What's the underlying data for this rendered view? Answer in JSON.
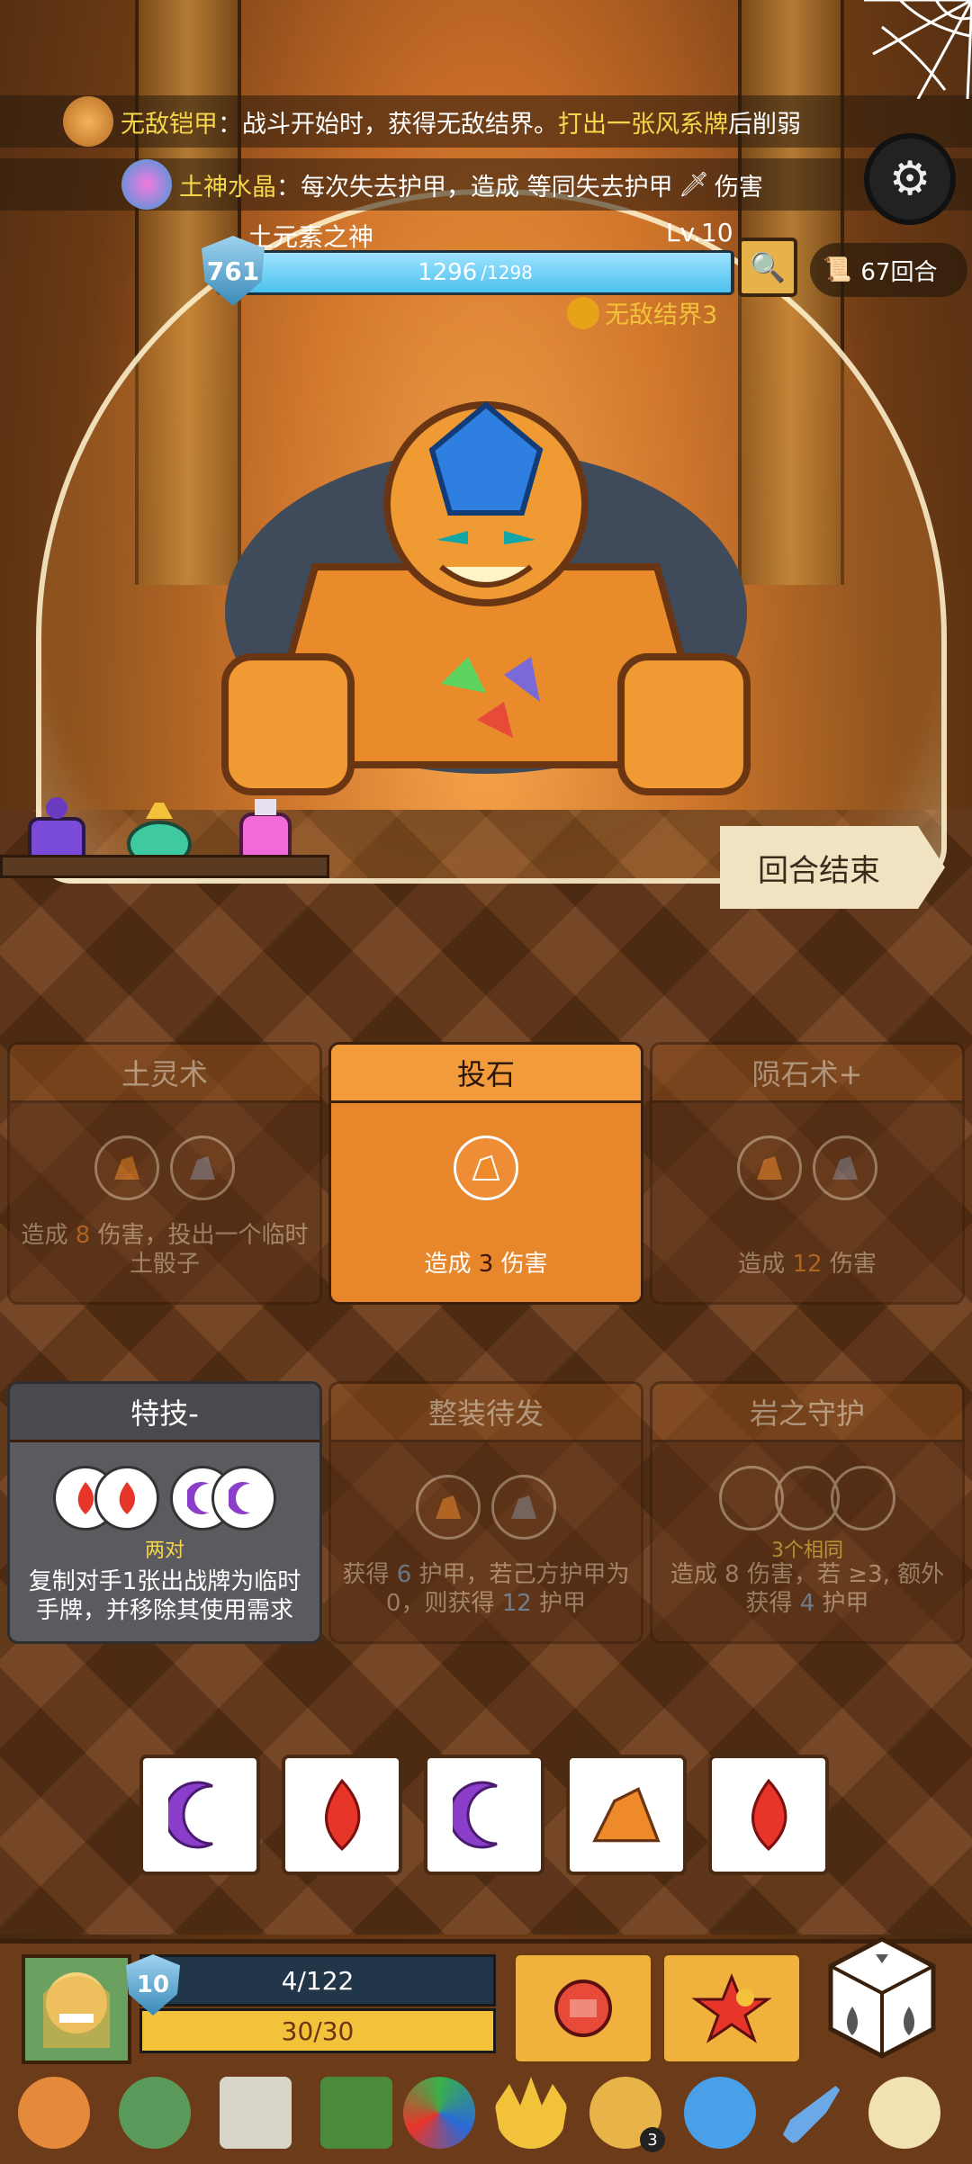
{
  "status_effects": [
    {
      "name": "无敌铠甲",
      "sep": "：",
      "text_before": "战斗开始时，获得无敌结界。",
      "highlight": "打出一张风系牌",
      "text_after": "后削弱"
    },
    {
      "name": "土神水晶",
      "sep": "：",
      "text": "每次失去护甲，造成 等同失去护甲",
      "text_after": "伤害"
    }
  ],
  "enemy": {
    "name": "土元素之神",
    "level": "Lv.10",
    "armor": "761",
    "hp": "1296",
    "hp_max": "/1298",
    "hp_fraction": 0.9985,
    "buff": "无敌结界3"
  },
  "turn_counter": "67回合",
  "end_turn_label": "回合结束",
  "cards_row1": [
    {
      "title": "土灵术",
      "desc_a": "造成",
      "value": "8",
      "desc_b": "伤害，投出一个临时土骰子",
      "state": "dim"
    },
    {
      "title": "投石",
      "desc_a": "造成",
      "value": "3",
      "desc_b": "伤害",
      "state": "active"
    },
    {
      "title": "陨石术+",
      "desc_a": "造成",
      "value": "12",
      "desc_b": "伤害",
      "state": "dim"
    }
  ],
  "cards_row2": [
    {
      "title": "特技-",
      "requirement": "两对",
      "desc": "复制对手1张出战牌为临时手牌，并移除其使用需求",
      "state": "special"
    },
    {
      "title": "整装待发",
      "desc_a": "获得",
      "value1": "6",
      "desc_b": "护甲，若己方护甲为0，则获得",
      "value2": "12",
      "desc_c": "护甲",
      "state": "dim"
    },
    {
      "title": "岩之守护",
      "requirement": "3个相同",
      "desc_a": "造成",
      "value1": "8",
      "desc_b": "伤害，若",
      "cond": "≥3,",
      "desc_c": "额外获得",
      "value2": "4",
      "desc_d": "护甲",
      "state": "dim"
    }
  ],
  "dice": [
    "moon",
    "fire",
    "moon",
    "rock",
    "fire"
  ],
  "player": {
    "armor": "10",
    "xp": "4/122",
    "hp": "30/30",
    "xp_fraction": 0.033,
    "hp_fraction": 1.0
  },
  "relic_badge": "3",
  "colors": {
    "moon": "#8b3ec9",
    "fire": "#e8352a",
    "rock": "#ef8a2a",
    "gold": "#f6d64a",
    "shield": "#3a8ab8"
  }
}
